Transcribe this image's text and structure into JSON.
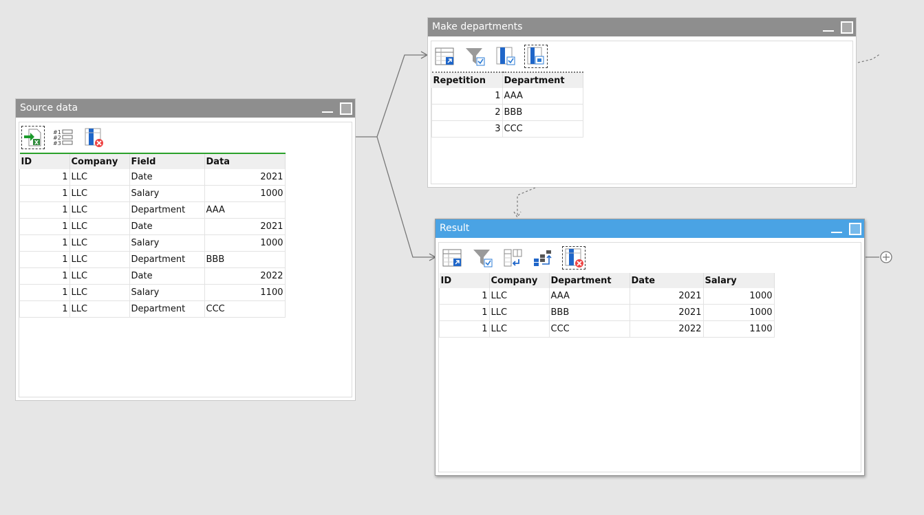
{
  "source": {
    "title": "Source data",
    "columns": [
      "ID",
      "Company",
      "Field",
      "Data"
    ],
    "rows": [
      [
        "1",
        "LLC",
        "Date",
        "2021"
      ],
      [
        "1",
        "LLC",
        "Salary",
        "1000"
      ],
      [
        "1",
        "LLC",
        "Department",
        "AAA"
      ],
      [
        "1",
        "LLC",
        "Date",
        "2021"
      ],
      [
        "1",
        "LLC",
        "Salary",
        "1000"
      ],
      [
        "1",
        "LLC",
        "Department",
        "BBB"
      ],
      [
        "1",
        "LLC",
        "Date",
        "2022"
      ],
      [
        "1",
        "LLC",
        "Salary",
        "1100"
      ],
      [
        "1",
        "LLC",
        "Department",
        "CCC"
      ]
    ],
    "numeric_cols": [
      0,
      3
    ],
    "toolbar": [
      "import-excel-icon",
      "numbered-list-icon",
      "remove-column-icon"
    ]
  },
  "departments": {
    "title": "Make departments",
    "columns": [
      "Repetition",
      "Department"
    ],
    "rows": [
      [
        "1",
        "AAA"
      ],
      [
        "2",
        "BBB"
      ],
      [
        "3",
        "CCC"
      ]
    ],
    "numeric_cols": [
      0
    ],
    "toolbar": [
      "export-table-icon",
      "filter-icon",
      "select-column-icon",
      "split-column-icon"
    ]
  },
  "result": {
    "title": "Result",
    "columns": [
      "ID",
      "Company",
      "Department",
      "Date",
      "Salary"
    ],
    "rows": [
      [
        "1",
        "LLC",
        "AAA",
        "2021",
        "1000"
      ],
      [
        "1",
        "LLC",
        "BBB",
        "2021",
        "1000"
      ],
      [
        "1",
        "LLC",
        "CCC",
        "2022",
        "1100"
      ]
    ],
    "numeric_cols": [
      0,
      3,
      4
    ],
    "toolbar": [
      "export-table-icon",
      "filter-icon",
      "pivot-icon",
      "sort-icon",
      "remove-column-icon"
    ]
  },
  "colors": {
    "titlebar_inactive": "#8e8e8e",
    "titlebar_active": "#4aa3e4",
    "source_header_line": "#2aa12a",
    "canvas": "#e6e6e6"
  }
}
